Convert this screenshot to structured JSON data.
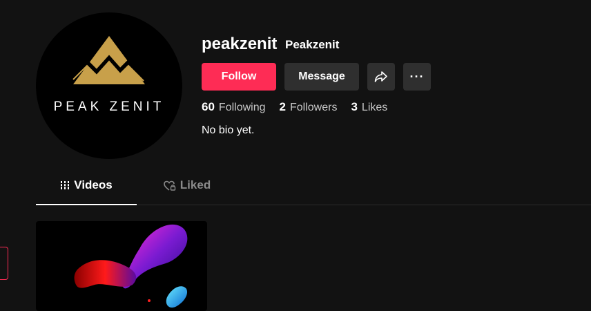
{
  "profile": {
    "avatar_text": "PEAK ZENIT",
    "username": "peakzenit",
    "nickname": "Peakzenit",
    "bio": "No bio yet."
  },
  "actions": {
    "follow_label": "Follow",
    "message_label": "Message",
    "share_icon": "share-arrow-icon",
    "more_label": "···"
  },
  "stats": {
    "following": {
      "value": "60",
      "label": "Following"
    },
    "followers": {
      "value": "2",
      "label": "Followers"
    },
    "likes": {
      "value": "3",
      "label": "Likes"
    }
  },
  "tabs": [
    {
      "label": "Videos",
      "icon": "grid-icon",
      "active": true
    },
    {
      "label": "Liked",
      "icon": "heart-lock-icon",
      "active": false
    }
  ],
  "colors": {
    "background": "#121212",
    "accent": "#fe2c55",
    "button_secondary": "#2f2f2f",
    "muted_text": "#8a8a8a"
  }
}
